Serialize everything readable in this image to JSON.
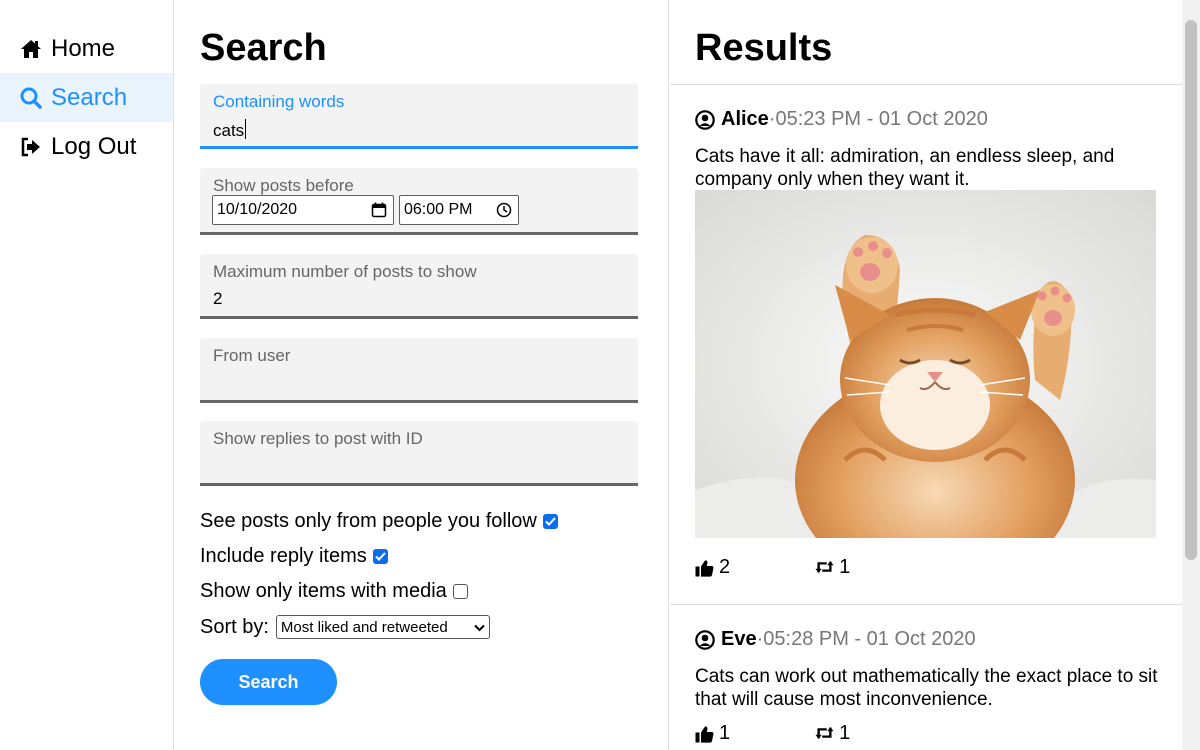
{
  "nav": {
    "home": "Home",
    "search": "Search",
    "logout": "Log Out"
  },
  "search": {
    "title": "Search",
    "containing_words": {
      "label": "Containing words",
      "value": "cats"
    },
    "posts_before": {
      "label": "Show posts before",
      "date": "10/10/2020",
      "time": "06:00 PM"
    },
    "max_posts": {
      "label": "Maximum number of posts to show",
      "value": "2"
    },
    "from_user": {
      "label": "From user",
      "value": ""
    },
    "replies_to": {
      "label": "Show replies to post with ID",
      "value": ""
    },
    "only_following": {
      "label": "See posts only from people you follow",
      "checked": true
    },
    "include_replies": {
      "label": "Include reply items",
      "checked": true
    },
    "only_media": {
      "label": "Show only items with media",
      "checked": false
    },
    "sort": {
      "label": "Sort by:",
      "selected": "Most liked and retweeted"
    },
    "button": "Search"
  },
  "results": {
    "title": "Results",
    "posts": [
      {
        "author": "Alice",
        "separator": " · ",
        "timestamp": "05:23 PM - 01 Oct 2020",
        "text": "Cats have it all: admiration, an endless sleep, and company only when they want it.",
        "likes": "2",
        "retweets": "1",
        "has_image": true
      },
      {
        "author": "Eve",
        "separator": " · ",
        "timestamp": "05:28 PM - 01 Oct 2020",
        "text": "Cats can work out mathematically the exact place to sit that will cause most inconvenience.",
        "likes": "1",
        "retweets": "1",
        "has_image": false
      }
    ]
  },
  "colors": {
    "accent": "#1e90ff",
    "active_bg": "#eaf4ff",
    "field_bg": "#f3f3f3",
    "checkbox": "#0a6cf0"
  },
  "icons": {
    "home": "home-icon",
    "search": "search-icon",
    "logout": "logout-icon",
    "user": "user-circle-icon",
    "like": "thumbs-up-icon",
    "retweet": "retweet-icon"
  }
}
